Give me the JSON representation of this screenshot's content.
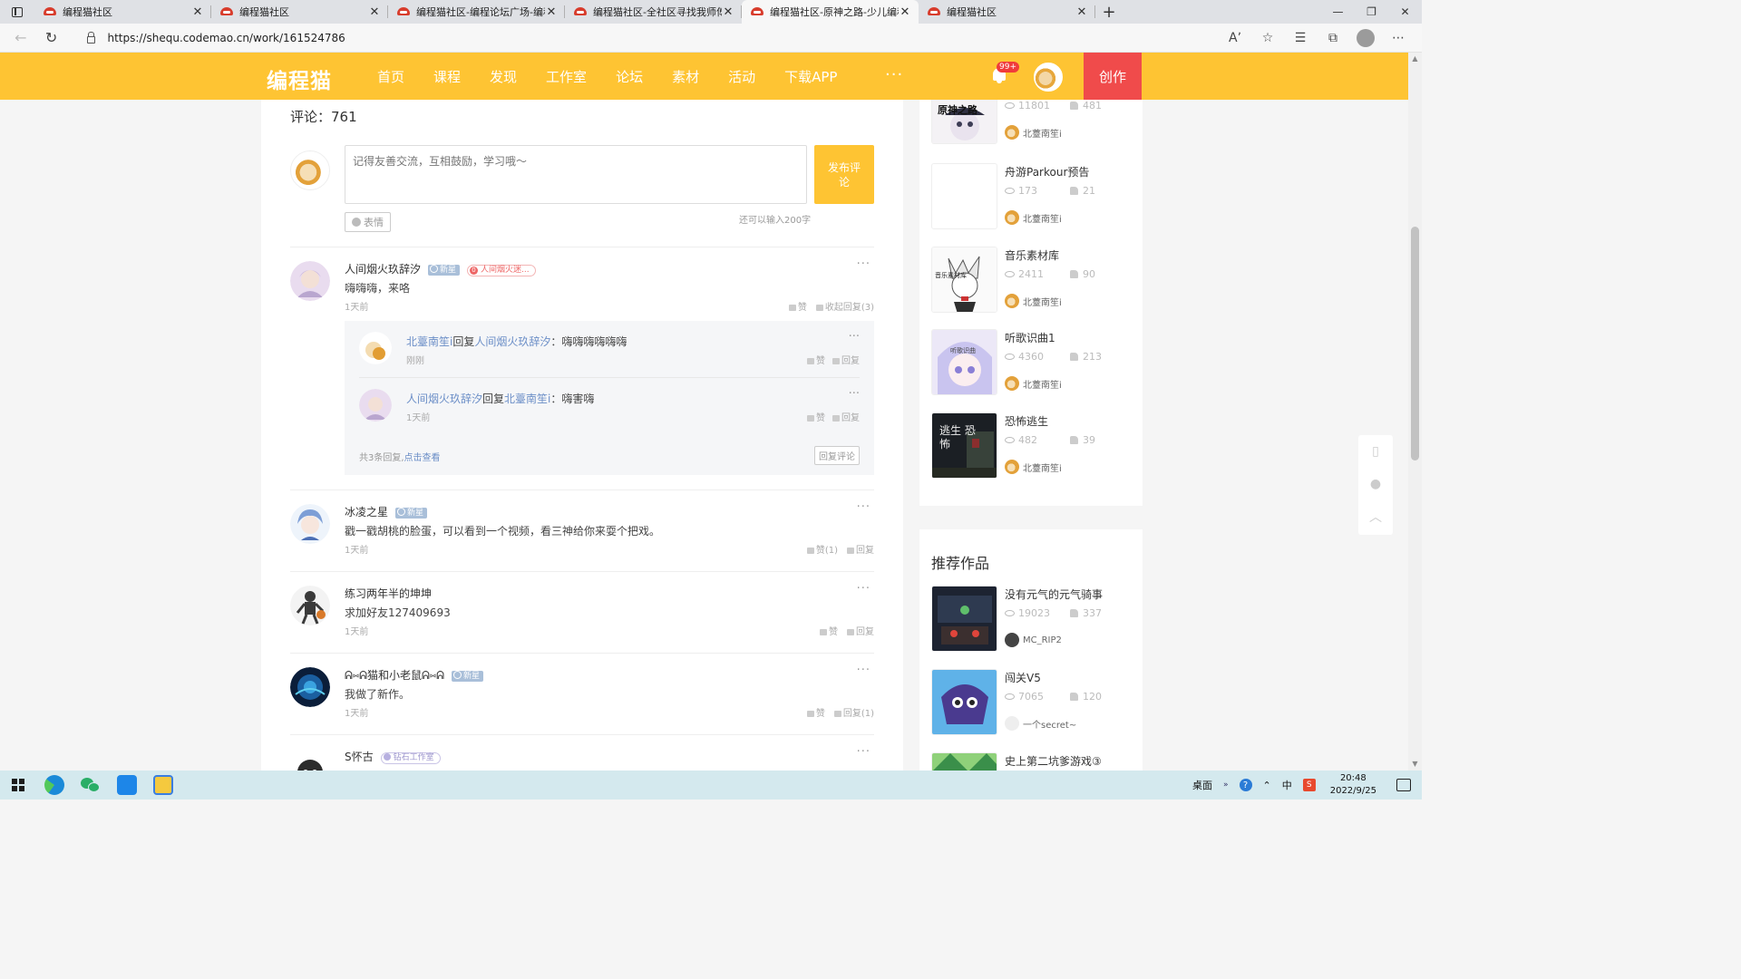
{
  "browser": {
    "tabs": [
      {
        "title": "编程猫社区",
        "active": false
      },
      {
        "title": "编程猫社区",
        "active": false
      },
      {
        "title": "编程猫社区-编程论坛广场-编程学",
        "active": false
      },
      {
        "title": "编程猫社区-全社区寻找我师傅!",
        "active": false
      },
      {
        "title": "编程猫社区-原神之路-少儿编程",
        "active": true
      },
      {
        "title": "编程猫社区",
        "active": false
      }
    ],
    "url": "https://shequ.codemao.cn/work/161524786"
  },
  "header": {
    "logo": "编程猫",
    "nav": [
      "首页",
      "课程",
      "发现",
      "工作室",
      "论坛",
      "素材",
      "活动",
      "下载APP"
    ],
    "more": "···",
    "notif_count": "99+",
    "create_label": "创作"
  },
  "comments_section": {
    "title": "评论：761",
    "input_placeholder": "记得友善交流，互相鼓励，学习哦～",
    "post_label": "发布评论",
    "emoji_label": "表情",
    "char_left": "还可以输入200字"
  },
  "comments": [
    {
      "name": "人间烟火玖辞汐",
      "badges": [
        {
          "type": "newstar",
          "label": "新星"
        },
        {
          "type": "studio",
          "label": "人间烟火迷..."
        }
      ],
      "text": "嗨嗨嗨，来咯",
      "time": "1天前",
      "actions": [
        "赞",
        "收起回复(3)"
      ],
      "replies": [
        {
          "from": "北薹南笙i",
          "verb": "回复",
          "to": "人间烟火玖辞汐",
          "text": "：嗨嗨嗨嗨嗨嗨",
          "time": "刚刚",
          "actions": [
            "赞",
            "回复"
          ]
        },
        {
          "from": "人间烟火玖辞汐",
          "verb": "回复",
          "to": "北薹南笙i",
          "text": "：嗨害嗨",
          "time": "1天前",
          "actions": [
            "赞",
            "回复"
          ]
        }
      ],
      "reply_total": "共3条回复,",
      "reply_view": "点击查看",
      "reply_button": "回复评论"
    },
    {
      "name": "冰凌之星",
      "badges": [
        {
          "type": "newstar",
          "label": "新星"
        }
      ],
      "text": "戳一戳胡桃的脸蛋，可以看到一个视频，看三神给你来耍个把戏。",
      "time": "1天前",
      "actions": [
        "赞(1)",
        "回复"
      ]
    },
    {
      "name": "练习两年半的坤坤",
      "badges": [],
      "text": "求加好友127409693",
      "time": "1天前",
      "actions": [
        "赞",
        "回复"
      ]
    },
    {
      "name": "ᕱ⑅ᕱ猫和小老鼠ᕱ⑅ᕱ",
      "badges": [
        {
          "type": "newstar",
          "label": "新星"
        }
      ],
      "text": "我做了新作。",
      "time": "1天前",
      "actions": [
        "赞",
        "回复(1)"
      ]
    },
    {
      "name": "S怀古",
      "badges": [
        {
          "type": "diamond",
          "label": "钻石工作室"
        }
      ],
      "text": "",
      "time": "",
      "actions": []
    }
  ],
  "sidebar_works": [
    {
      "title": "",
      "views": "11801",
      "likes": "481",
      "author": "北薹南笙i",
      "thumb_text": "原神之路"
    },
    {
      "title": "舟游Parkour预告",
      "views": "173",
      "likes": "21",
      "author": "北薹南笙i",
      "thumb_text": ""
    },
    {
      "title": "音乐素材库",
      "views": "2411",
      "likes": "90",
      "author": "北薹南笙i",
      "thumb_text": "音乐素材库"
    },
    {
      "title": "听歌识曲1",
      "views": "4360",
      "likes": "213",
      "author": "北薹南笙i",
      "thumb_text": "听歌识曲"
    },
    {
      "title": "恐怖逃生",
      "views": "482",
      "likes": "39",
      "author": "北薹南笙i",
      "thumb_text": "逃生 恐怖"
    }
  ],
  "recommend": {
    "title": "推荐作品",
    "works": [
      {
        "title": "没有元气的元气骑事",
        "views": "19023",
        "likes": "337",
        "author": "MC_RIP2"
      },
      {
        "title": "闯关V5",
        "views": "7065",
        "likes": "120",
        "author": "一个secret~"
      },
      {
        "title": "史上第二坑爹游戏③",
        "views": "",
        "likes": "",
        "author": ""
      }
    ]
  },
  "taskbar": {
    "desktop_label": "桌面",
    "ime": "中",
    "time": "20:48",
    "date": "2022/9/25"
  },
  "colors": {
    "brand": "#fec433",
    "create": "#f04b4b",
    "link": "#6b8ec7"
  }
}
